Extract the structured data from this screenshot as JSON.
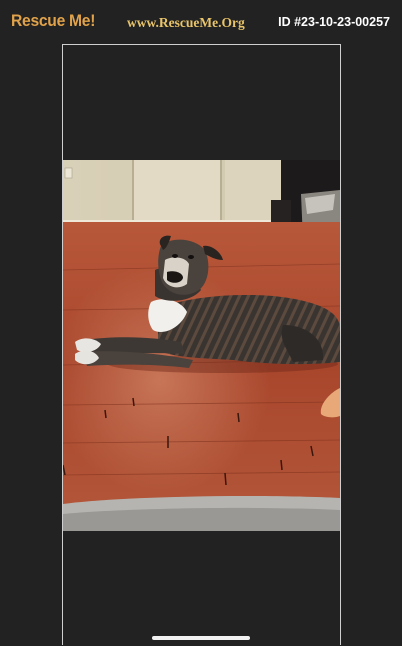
{
  "header": {
    "logo_text": "Rescue Me!",
    "site_url": "www.RescueMe.Org",
    "pet_id": "ID #23-10-23-00257"
  },
  "photo": {
    "subject": "dog-photo"
  },
  "colors": {
    "background": "#222222",
    "logo": "#e0a24a",
    "site_url": "#e8c46a",
    "id_text": "#ffffff",
    "frame_border": "#cfcfcf"
  }
}
